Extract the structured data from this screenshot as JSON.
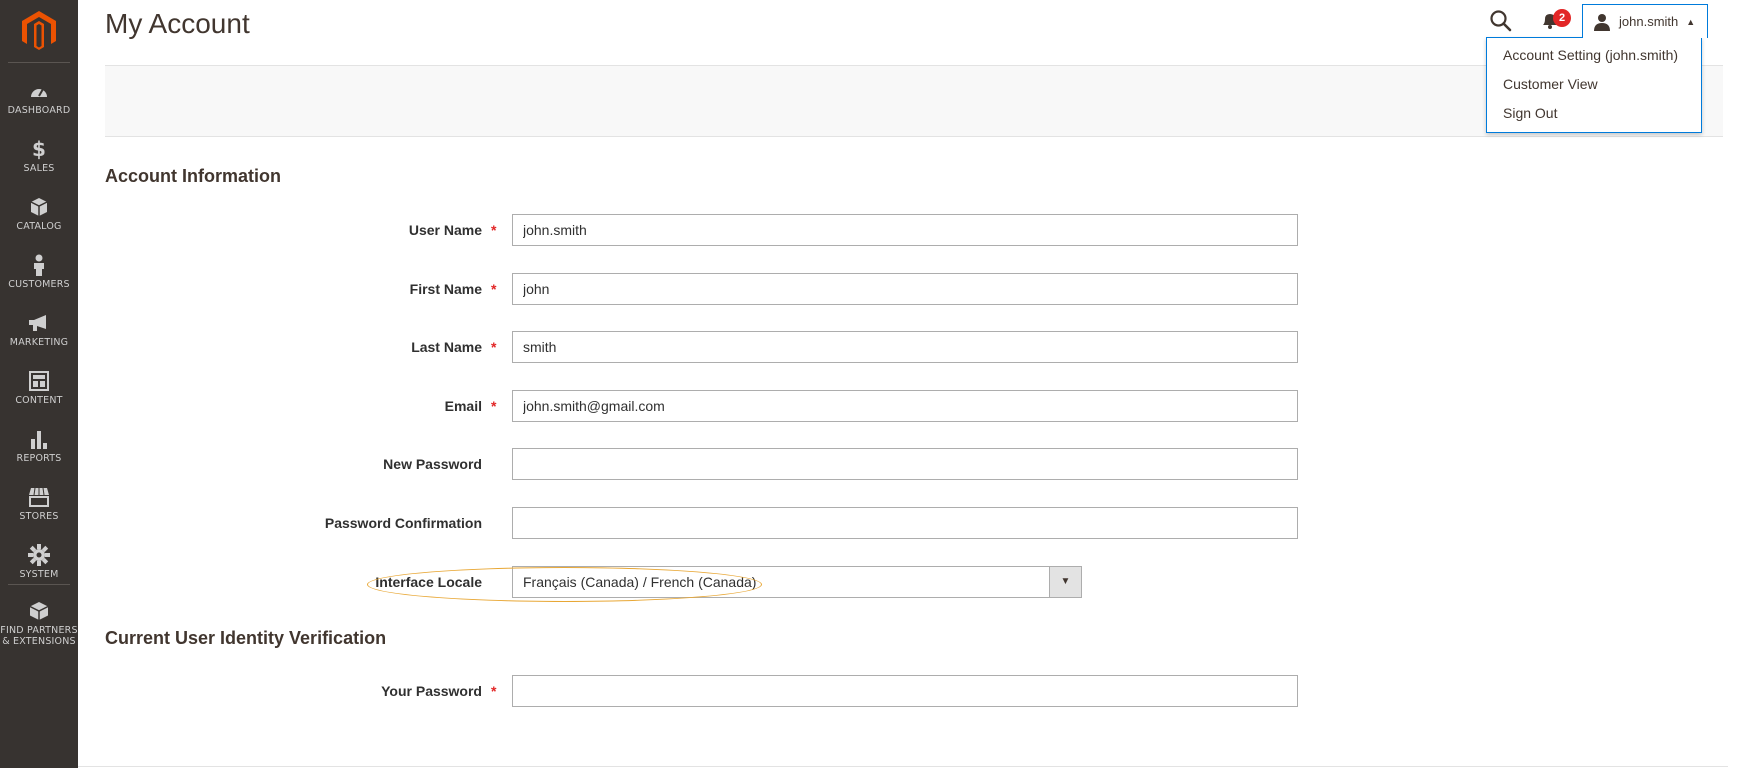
{
  "page": {
    "title": "My Account"
  },
  "sidebar": {
    "items": [
      {
        "key": "dashboard",
        "label": "DASHBOARD",
        "icon": "dashboard-icon"
      },
      {
        "key": "sales",
        "label": "SALES",
        "icon": "dollar-icon"
      },
      {
        "key": "catalog",
        "label": "CATALOG",
        "icon": "box-icon"
      },
      {
        "key": "customers",
        "label": "CUSTOMERS",
        "icon": "person-icon"
      },
      {
        "key": "marketing",
        "label": "MARKETING",
        "icon": "megaphone-icon"
      },
      {
        "key": "content",
        "label": "CONTENT",
        "icon": "layout-icon"
      },
      {
        "key": "reports",
        "label": "REPORTS",
        "icon": "bar-chart-icon"
      },
      {
        "key": "stores",
        "label": "STORES",
        "icon": "store-icon"
      },
      {
        "key": "system",
        "label": "SYSTEM",
        "icon": "gear-icon"
      },
      {
        "key": "partners",
        "label": "FIND PARTNERS & EXTENSIONS",
        "icon": "cube-icon"
      }
    ]
  },
  "header": {
    "notifications_count": "2",
    "user_name": "john.smith",
    "user_caret": "▲",
    "dropdown": [
      {
        "label": "Account Setting (john.smith)"
      },
      {
        "label": "Customer View"
      },
      {
        "label": "Sign Out"
      }
    ]
  },
  "account_info": {
    "title": "Account Information",
    "fields": {
      "username": {
        "label": "User Name",
        "value": "john.smith",
        "required": "*"
      },
      "firstname": {
        "label": "First Name",
        "value": "john",
        "required": "*"
      },
      "lastname": {
        "label": "Last Name",
        "value": "smith",
        "required": "*"
      },
      "email": {
        "label": "Email",
        "value": "john.smith@gmail.com",
        "required": "*"
      },
      "new_password": {
        "label": "New Password",
        "value": ""
      },
      "password_confirm": {
        "label": "Password Confirmation",
        "value": ""
      },
      "locale": {
        "label": "Interface Locale",
        "value": "Français (Canada) / French (Canada)"
      }
    }
  },
  "verification": {
    "title": "Current User Identity Verification",
    "fields": {
      "your_password": {
        "label": "Your Password",
        "value": "",
        "required": "*"
      }
    }
  },
  "colors": {
    "sidebar_bg": "#373330",
    "accent_orange": "#eb5202",
    "highlight": "#e8a735",
    "required": "#e22626",
    "focus_blue": "#007bdb"
  }
}
